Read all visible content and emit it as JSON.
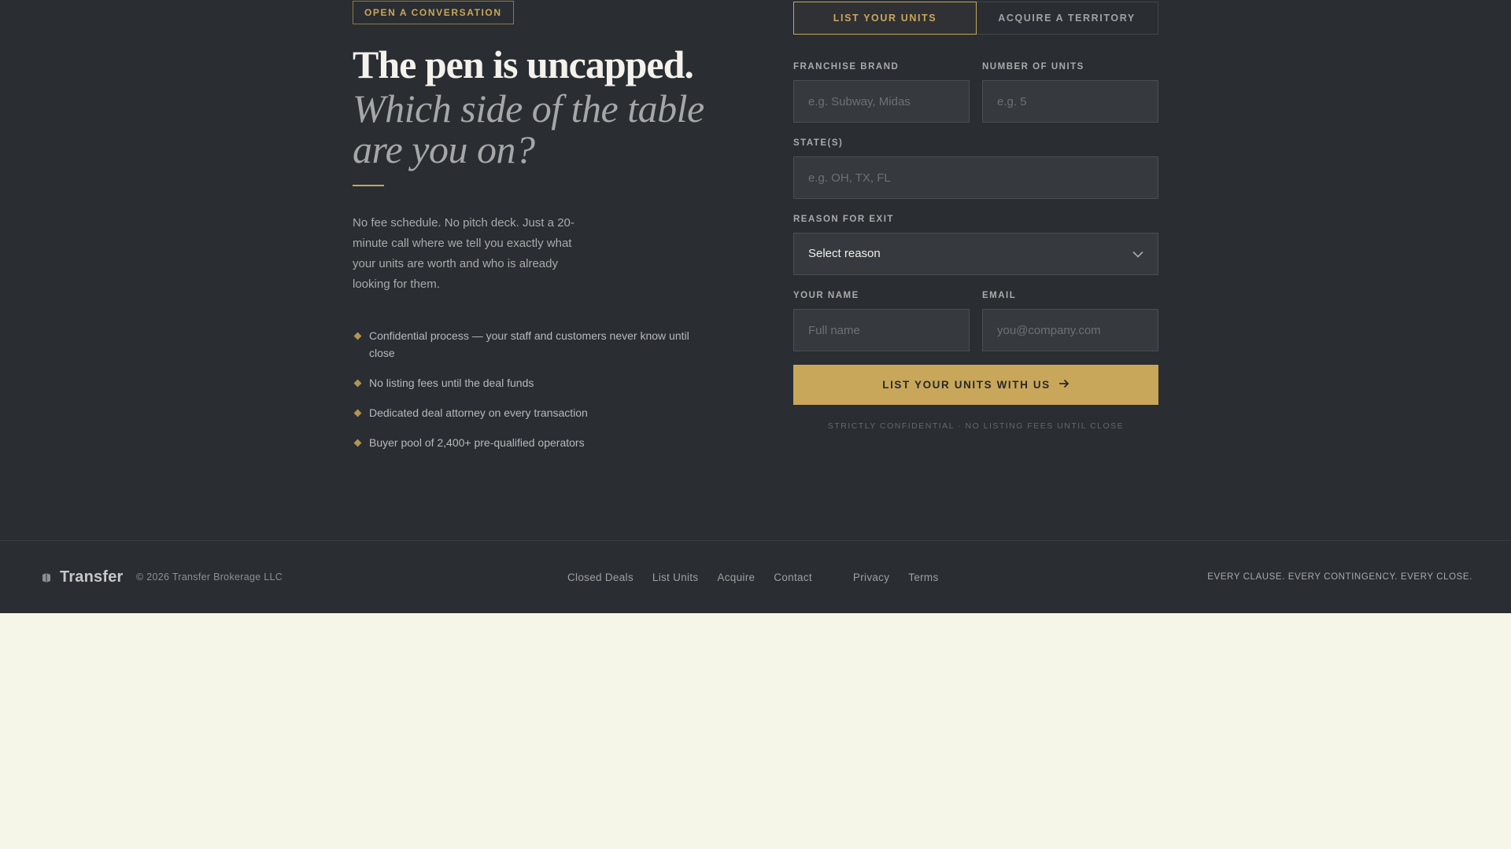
{
  "hero": {
    "eyebrow": "OPEN A CONVERSATION",
    "headline_line1": "The pen is uncapped.",
    "headline_line2": "Which side of the table are you on?",
    "lede": "No fee schedule. No pitch deck. Just a 20-minute call where we tell you exactly what your units are worth and who is already looking for them.",
    "bullets": [
      "Confidential process — your staff and customers never know until close",
      "No listing fees until the deal funds",
      "Dedicated deal attorney on every transaction",
      "Buyer pool of 2,400+ pre-qualified operators"
    ]
  },
  "form": {
    "tabs": [
      {
        "label": "LIST YOUR UNITS",
        "active": true
      },
      {
        "label": "ACQUIRE A TERRITORY",
        "active": false
      }
    ],
    "franchise_brand": {
      "label": "FRANCHISE BRAND",
      "placeholder": "e.g. Subway, Midas",
      "value": ""
    },
    "number_of_units": {
      "label": "NUMBER OF UNITS",
      "placeholder": "e.g. 5",
      "value": ""
    },
    "states": {
      "label": "STATE(S)",
      "placeholder": "e.g. OH, TX, FL",
      "value": ""
    },
    "reason": {
      "label": "REASON FOR EXIT",
      "selected": "Select reason"
    },
    "your_name": {
      "label": "YOUR NAME",
      "placeholder": "Full name",
      "value": ""
    },
    "email": {
      "label": "EMAIL",
      "placeholder": "you@company.com",
      "value": ""
    },
    "submit_label": "LIST YOUR UNITS WITH US",
    "fineprint": "STRICTLY CONFIDENTIAL · NO LISTING FEES UNTIL CLOSE"
  },
  "footer": {
    "brand": "Transfer",
    "copyright": "© 2026 Transfer Brokerage LLC",
    "nav": [
      "Closed Deals",
      "List Units",
      "Acquire",
      "Contact"
    ],
    "legal": [
      "Privacy",
      "Terms"
    ],
    "tagline": "EVERY CLAUSE. EVERY CONTINGENCY. EVERY CLOSE."
  },
  "colors": {
    "background_dark": "#2a2d31",
    "accent_gold": "#c9a75a",
    "page_below": "#f6f6e8"
  },
  "icons": [
    "diamond-bullet-icon",
    "chevron-down-icon",
    "arrow-right-icon",
    "brand-mark-icon"
  ]
}
